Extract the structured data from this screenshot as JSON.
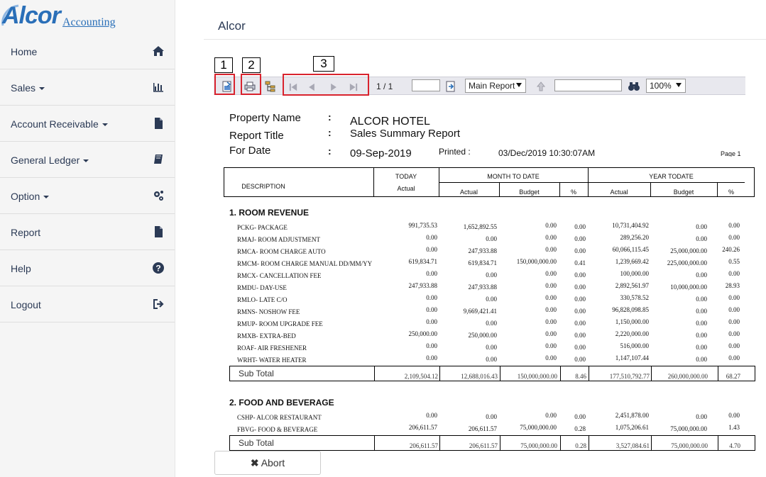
{
  "logo": {
    "wordmark": "Alcor",
    "sub": "Accounting"
  },
  "sidebar": {
    "items": [
      {
        "label": "Home",
        "icon": "home-icon",
        "dropdown": false
      },
      {
        "label": "Sales",
        "icon": "bar-chart-icon",
        "dropdown": true
      },
      {
        "label": "Account Receivable",
        "icon": "file-icon",
        "dropdown": true
      },
      {
        "label": "General Ledger",
        "icon": "book-icon",
        "dropdown": true
      },
      {
        "label": "Option",
        "icon": "gears-icon",
        "dropdown": true
      },
      {
        "label": "Report",
        "icon": "file-icon",
        "dropdown": false
      },
      {
        "label": "Help",
        "icon": "question-circle-icon",
        "dropdown": false
      },
      {
        "label": "Logout",
        "icon": "sign-out-icon",
        "dropdown": false
      }
    ]
  },
  "page": {
    "title": "Alcor"
  },
  "callouts": [
    "1",
    "2",
    "3"
  ],
  "toolbar": {
    "page_indicator": "1 / 1",
    "report_select": "Main Report",
    "zoom_select": "100%"
  },
  "report": {
    "labels": {
      "property": "Property Name",
      "title": "Report Title",
      "date": "For Date",
      "printed": "Printed :",
      "page": "Page 1"
    },
    "property_name": "ALCOR HOTEL",
    "report_title": "Sales Summary Report",
    "for_date": "09-Sep-2019",
    "printed_at": "03/Dec/2019  10:30:07AM",
    "columns": {
      "description": "DESCRIPTION",
      "today": "TODAY",
      "today_actual": "Actual",
      "mtd": "MONTH TO DATE",
      "ytd": "YEAR TODATE",
      "actual": "Actual",
      "budget": "Budget",
      "pct": "%"
    },
    "sections": [
      {
        "title": "1. ROOM REVENUE",
        "rows": [
          [
            "PCKG- PACKAGE",
            "991,735.53",
            "1,652,892.55",
            "0.00",
            "0.00",
            "10,731,404.92",
            "0.00",
            "0.00"
          ],
          [
            "RMAJ- ROOM ADJUSTMENT",
            "0.00",
            "0.00",
            "0.00",
            "0.00",
            "289,256.20",
            "0.00",
            "0.00"
          ],
          [
            "RMCA- ROOM CHARGE AUTO",
            "0.00",
            "247,933.88",
            "0.00",
            "0.00",
            "60,066,115.45",
            "25,000,000.00",
            "240.26"
          ],
          [
            "RMCM- ROOM CHARGE MANUAL  DD/MM/YY",
            "619,834.71",
            "619,834.71",
            "150,000,000.00",
            "0.41",
            "1,239,669.42",
            "225,000,000.00",
            "0.55"
          ],
          [
            "RMCX- CANCELLATION FEE",
            "0.00",
            "0.00",
            "0.00",
            "0.00",
            "100,000.00",
            "0.00",
            "0.00"
          ],
          [
            "RMDU- DAY-USE",
            "247,933.88",
            "247,933.88",
            "0.00",
            "0.00",
            "2,892,561.97",
            "10,000,000.00",
            "28.93"
          ],
          [
            "RMLO- LATE C/O",
            "0.00",
            "0.00",
            "0.00",
            "0.00",
            "330,578.52",
            "0.00",
            "0.00"
          ],
          [
            "RMNS- NOSHOW FEE",
            "0.00",
            "9,669,421.41",
            "0.00",
            "0.00",
            "96,828,098.85",
            "0.00",
            "0.00"
          ],
          [
            "RMUP- ROOM UPGRADE FEE",
            "0.00",
            "0.00",
            "0.00",
            "0.00",
            "1,150,000.00",
            "0.00",
            "0.00"
          ],
          [
            "RMXB- EXTRA-BED",
            "250,000.00",
            "250,000.00",
            "0.00",
            "0.00",
            "2,220,000.00",
            "0.00",
            "0.00"
          ],
          [
            "ROAF- AIR FRESHENER",
            "0.00",
            "0.00",
            "0.00",
            "0.00",
            "516,000.00",
            "0.00",
            "0.00"
          ],
          [
            "WRHT- WATER HEATER",
            "0.00",
            "0.00",
            "0.00",
            "0.00",
            "1,147,107.44",
            "0.00",
            "0.00"
          ]
        ],
        "subtotal": [
          "Sub Total",
          "2,109,504.12",
          "12,688,016.43",
          "150,000,000.00",
          "8.46",
          "177,510,792.77",
          "260,000,000.00",
          "68.27"
        ]
      },
      {
        "title": "2. FOOD AND BEVERAGE",
        "rows": [
          [
            "CSHP- ALCOR RESTAURANT",
            "0.00",
            "0.00",
            "0.00",
            "0.00",
            "2,451,878.00",
            "0.00",
            "0.00"
          ],
          [
            "FBVG- FOOD & BEVERAGE",
            "206,611.57",
            "206,611.57",
            "75,000,000.00",
            "0.28",
            "1,075,206.61",
            "75,000,000.00",
            "1.43"
          ]
        ],
        "subtotal": [
          "Sub Total",
          "206,611.57",
          "206,611.57",
          "75,000,000.00",
          "0.28",
          "3,527,084.61",
          "75,000,000.00",
          "4.70"
        ]
      }
    ]
  },
  "abort_button": {
    "label": "Abort",
    "icon": "times-icon"
  },
  "colors": {
    "brand": "#2a6fb8",
    "nav_text": "#2b3a55",
    "highlight": "#d9232e"
  }
}
